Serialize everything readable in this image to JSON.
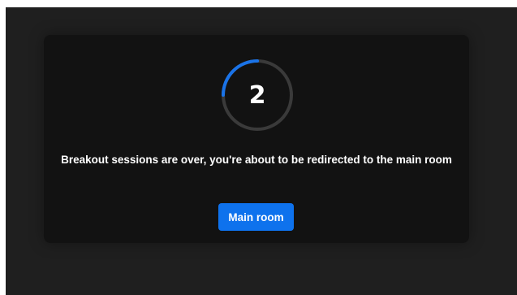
{
  "countdown": {
    "value": "2",
    "progress": 0.25,
    "track_color": "#3a3a3a",
    "progress_color": "#1a73e8"
  },
  "dialog": {
    "message": "Breakout sessions are over, you're about to be redirected to the main room",
    "button_label": "Main room",
    "button_color": "#0e72ed"
  }
}
